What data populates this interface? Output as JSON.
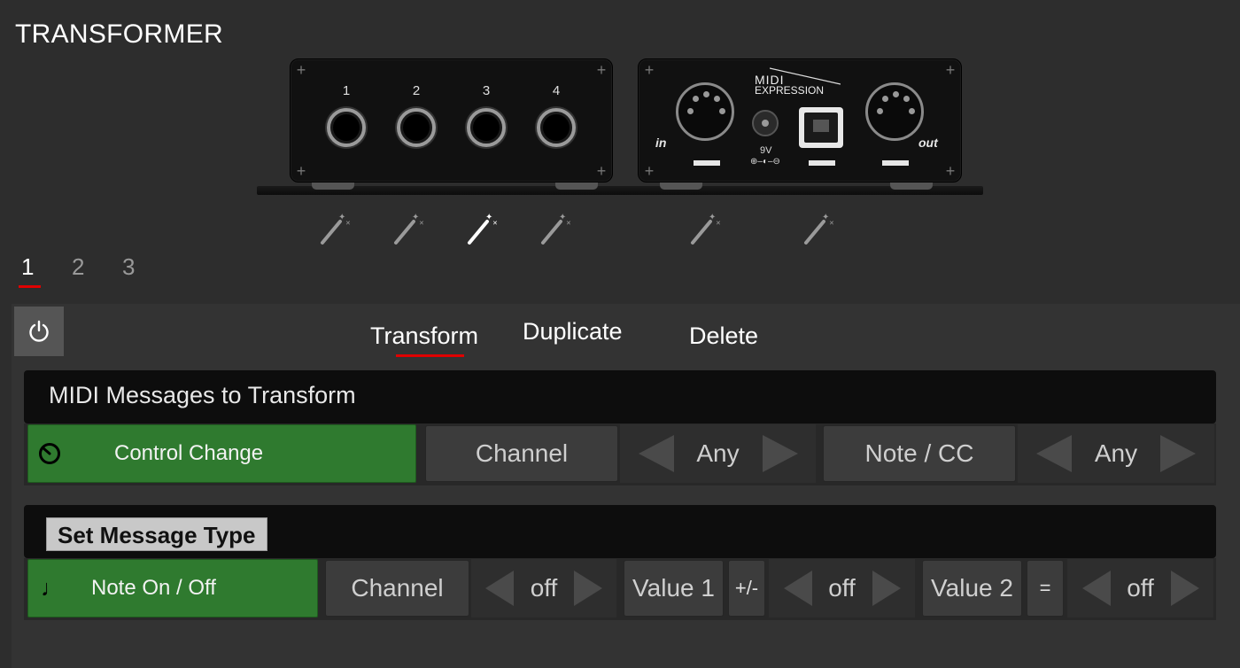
{
  "app": {
    "title": "TRANSFORMER"
  },
  "device": {
    "jacks": [
      "1",
      "2",
      "3",
      "4"
    ],
    "brand_line1": "MIDI",
    "brand_line2": "EXPRESSION",
    "in_label": "in",
    "out_label": "out",
    "dc_label": "9V",
    "dc_symbol": "⊕–◐–⊖"
  },
  "wands": [
    {
      "id": "jack-1",
      "active": false
    },
    {
      "id": "jack-2",
      "active": false
    },
    {
      "id": "jack-3",
      "active": true
    },
    {
      "id": "jack-4",
      "active": false
    },
    {
      "id": "midi-in",
      "active": false
    },
    {
      "id": "usb",
      "active": false
    }
  ],
  "slots": {
    "items": [
      "1",
      "2",
      "3"
    ],
    "active": "1"
  },
  "modes": {
    "transform": "Transform",
    "duplicate": "Duplicate",
    "delete": "Delete",
    "active": "Transform"
  },
  "source": {
    "header": "MIDI Messages to Transform",
    "type_label": "Control Change",
    "channel_label": "Channel",
    "channel_value": "Any",
    "notecc_label": "Note / CC",
    "notecc_value": "Any"
  },
  "target": {
    "header_tag": "Set Message Type",
    "type_label": "Note On / Off",
    "channel_label": "Channel",
    "channel_value": "off",
    "value1_label": "Value 1",
    "value1_op": "+/-",
    "value1_value": "off",
    "value2_label": "Value 2",
    "value2_op": "=",
    "value2_value": "off"
  },
  "colors": {
    "accent_red": "#e00000",
    "active_green": "#2f7a2f",
    "background": "#2d2d2d"
  }
}
